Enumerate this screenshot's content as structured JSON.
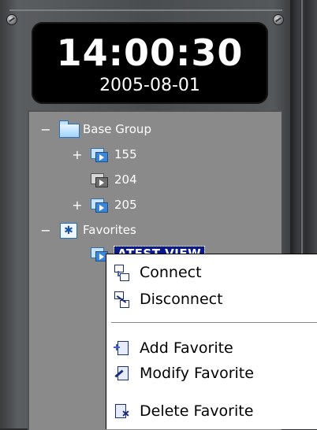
{
  "clock": {
    "time": "14:00:30",
    "date": "2005-08-01"
  },
  "tree": {
    "items": [
      {
        "label": "Base Group",
        "expander": "−",
        "icon": "folder-icon"
      },
      {
        "label": "155",
        "expander": "+",
        "icon": "camera-group-icon"
      },
      {
        "label": "204",
        "expander": "",
        "icon": "camera-offline-icon"
      },
      {
        "label": "205",
        "expander": "+",
        "icon": "camera-group-icon"
      },
      {
        "label": "Favorites",
        "expander": "−",
        "icon": "favorites-folder-icon"
      },
      {
        "label": "ATEST VIEW",
        "expander": "",
        "icon": "favorite-view-icon",
        "selected": true
      }
    ]
  },
  "context_menu": {
    "items": [
      {
        "label": "Connect",
        "icon": "connect-icon"
      },
      {
        "label": "Disconnect",
        "icon": "disconnect-icon"
      },
      {
        "label": "Add Favorite",
        "icon": "add-favorite-icon"
      },
      {
        "label": "Modify Favorite",
        "icon": "modify-favorite-icon"
      },
      {
        "label": "Delete Favorite",
        "icon": "delete-favorite-icon"
      }
    ]
  },
  "colors": {
    "panel": "#8a8a8a",
    "selection": "#0a1a8a",
    "clock_bg": "#000000"
  }
}
